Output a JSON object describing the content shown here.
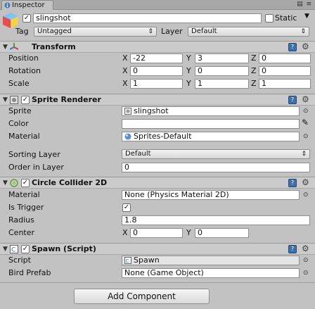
{
  "tab": {
    "label": "Inspector"
  },
  "object": {
    "active": true,
    "name": "slingshot",
    "static_label": "Static",
    "tag_label": "Tag",
    "tag_value": "Untagged",
    "layer_label": "Layer",
    "layer_value": "Default"
  },
  "transform": {
    "title": "Transform",
    "position": {
      "label": "Position",
      "x": "-22",
      "y": "3",
      "z": "0"
    },
    "rotation": {
      "label": "Rotation",
      "x": "0",
      "y": "0",
      "z": "0"
    },
    "scale": {
      "label": "Scale",
      "x": "1",
      "y": "1",
      "z": "1"
    },
    "axes": {
      "x": "X",
      "y": "Y",
      "z": "Z"
    }
  },
  "sprite_renderer": {
    "title": "Sprite Renderer",
    "enabled": true,
    "sprite_label": "Sprite",
    "sprite_value": "slingshot",
    "color_label": "Color",
    "color_value": "#ffffff",
    "material_label": "Material",
    "material_value": "Sprites-Default",
    "sorting_layer_label": "Sorting Layer",
    "sorting_layer_value": "Default",
    "order_label": "Order in Layer",
    "order_value": "0"
  },
  "circle_collider": {
    "title": "Circle Collider 2D",
    "enabled": true,
    "material_label": "Material",
    "material_value": "None (Physics Material 2D)",
    "trigger_label": "Is Trigger",
    "trigger_value": true,
    "radius_label": "Radius",
    "radius_value": "1.8",
    "center_label": "Center",
    "center_x": "0",
    "center_y": "0"
  },
  "spawn_script": {
    "title": "Spawn (Script)",
    "enabled": true,
    "script_label": "Script",
    "script_value": "Spawn",
    "prefab_label": "Bird Prefab",
    "prefab_value": "None (Game Object)"
  },
  "add_component": {
    "label": "Add Component"
  },
  "icons": {
    "gameobject": "cube-icon",
    "transform": "transform-axes-icon",
    "sprite": "sprite-renderer-icon",
    "collider": "circle-collider-icon",
    "script": "script-icon",
    "help": "book-icon",
    "settings": "gear-icon",
    "picker": "object-picker-icon",
    "eyedropper": "eyedropper-icon"
  }
}
